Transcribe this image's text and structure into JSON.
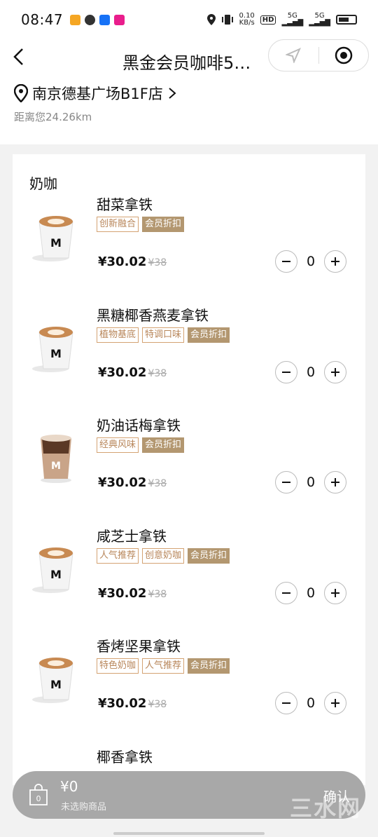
{
  "status_bar": {
    "time": "08:47",
    "net_speed_top": "0.10",
    "net_speed_bottom": "KB/s",
    "sig1": "5G",
    "sig2": "5G"
  },
  "header": {
    "title": "黑金会员咖啡5…",
    "store_name": "南京德基广场B1F店",
    "distance": "距离您24.26km"
  },
  "menu": {
    "category": "奶咖",
    "items": [
      {
        "name": "甜菜拿铁",
        "tags": [
          {
            "text": "创新融合",
            "solid": false
          },
          {
            "text": "会员折扣",
            "solid": true
          }
        ],
        "price": "¥30.02",
        "orig_price": "¥38",
        "qty": "0",
        "cup": "white"
      },
      {
        "name": "黑糖椰香燕麦拿铁",
        "tags": [
          {
            "text": "植物基底",
            "solid": false
          },
          {
            "text": "特调口味",
            "solid": false
          },
          {
            "text": "会员折扣",
            "solid": true
          }
        ],
        "price": "¥30.02",
        "orig_price": "¥38",
        "qty": "0",
        "cup": "white"
      },
      {
        "name": "奶油话梅拿铁",
        "tags": [
          {
            "text": "经典风味",
            "solid": false
          },
          {
            "text": "会员折扣",
            "solid": true
          }
        ],
        "price": "¥30.02",
        "orig_price": "¥38",
        "qty": "0",
        "cup": "iced"
      },
      {
        "name": "咸芝士拿铁",
        "tags": [
          {
            "text": "人气推荐",
            "solid": false
          },
          {
            "text": "创意奶咖",
            "solid": false
          },
          {
            "text": "会员折扣",
            "solid": true
          }
        ],
        "price": "¥30.02",
        "orig_price": "¥38",
        "qty": "0",
        "cup": "white"
      },
      {
        "name": "香烤坚果拿铁",
        "tags": [
          {
            "text": "特色奶咖",
            "solid": false
          },
          {
            "text": "人气推荐",
            "solid": false
          },
          {
            "text": "会员折扣",
            "solid": true
          }
        ],
        "price": "¥30.02",
        "orig_price": "¥38",
        "qty": "0",
        "cup": "white"
      },
      {
        "name": "椰香拿铁",
        "tags": [],
        "price": "",
        "orig_price": "",
        "qty": "",
        "cup": ""
      }
    ]
  },
  "cart": {
    "count": "0",
    "total": "¥0",
    "hint": "未选购商品",
    "confirm_label": "确认"
  },
  "watermark": "三水网",
  "colors": {
    "tag_border": "#d4a373",
    "tag_solid": "#b39770",
    "cart_bg": "#a8a8a8"
  }
}
